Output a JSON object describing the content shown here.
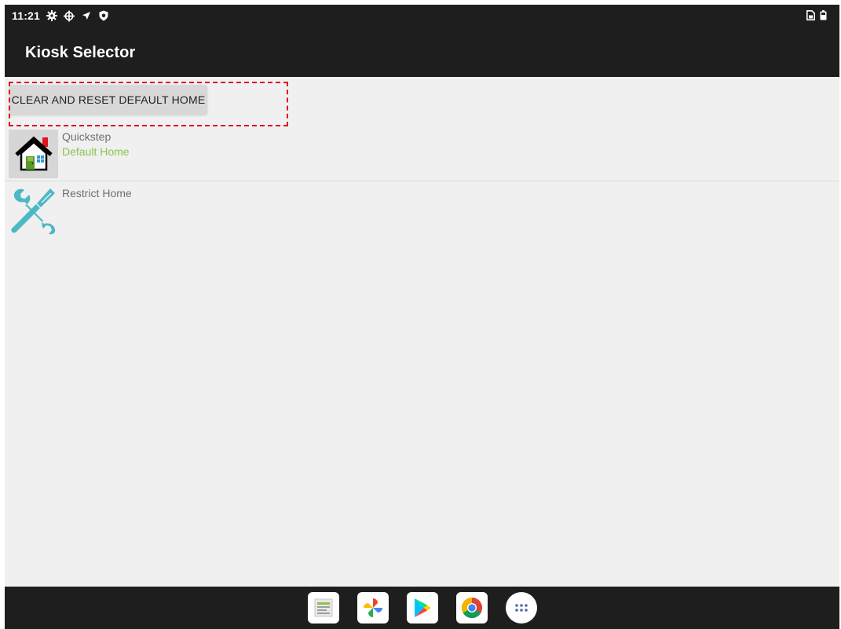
{
  "status_bar": {
    "time": "11:21",
    "icons": [
      "gear-icon",
      "crosshair-icon",
      "location-arrow-icon",
      "shield-icon"
    ],
    "right_icons": [
      "sim-card-icon",
      "battery-icon"
    ]
  },
  "app_bar": {
    "title": "Kiosk Selector"
  },
  "reset_button": {
    "label": "CLEAR AND RESET DEFAULT HOME"
  },
  "launchers": [
    {
      "title": "Quickstep",
      "subtitle": "Default Home",
      "icon": "house-icon"
    },
    {
      "title": "Restrict Home",
      "subtitle": "",
      "icon": "wrench-screwdriver-icon"
    }
  ],
  "dock": [
    "files-icon",
    "pinwheel-photos-icon",
    "play-store-icon",
    "chrome-icon",
    "app-drawer-icon"
  ],
  "colors": {
    "bar_background": "#1e1e1e",
    "content_background": "#f0f0f0",
    "default_home_green": "#8bc34a",
    "highlight_red": "#e0141e",
    "tool_icon_teal": "#4cb8c4"
  }
}
